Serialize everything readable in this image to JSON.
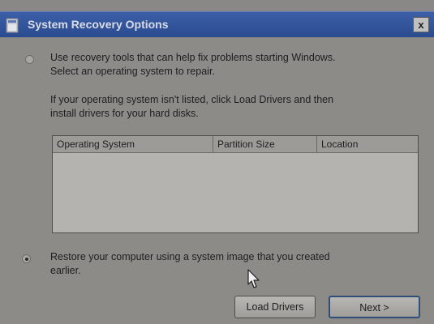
{
  "window": {
    "title": "System Recovery Options",
    "close_label": "x"
  },
  "option_repair": {
    "selected": false,
    "line1": "Use recovery tools that can help fix problems starting Windows.",
    "line2": "Select an operating system to repair."
  },
  "hint": {
    "line1": "If your operating system isn't listed, click Load Drivers and then",
    "line2": "install drivers for your hard disks."
  },
  "os_table": {
    "columns": [
      "Operating System",
      "Partition Size",
      "Location"
    ],
    "rows": []
  },
  "option_restore": {
    "selected": true,
    "line1": "Restore your computer using a system image that you created",
    "line2": "earlier."
  },
  "buttons": {
    "load_drivers": "Load Drivers",
    "next": "Next >"
  },
  "icons": {
    "window": "windows-icon",
    "close": "close-icon",
    "cursor": "mouse-cursor-icon"
  }
}
